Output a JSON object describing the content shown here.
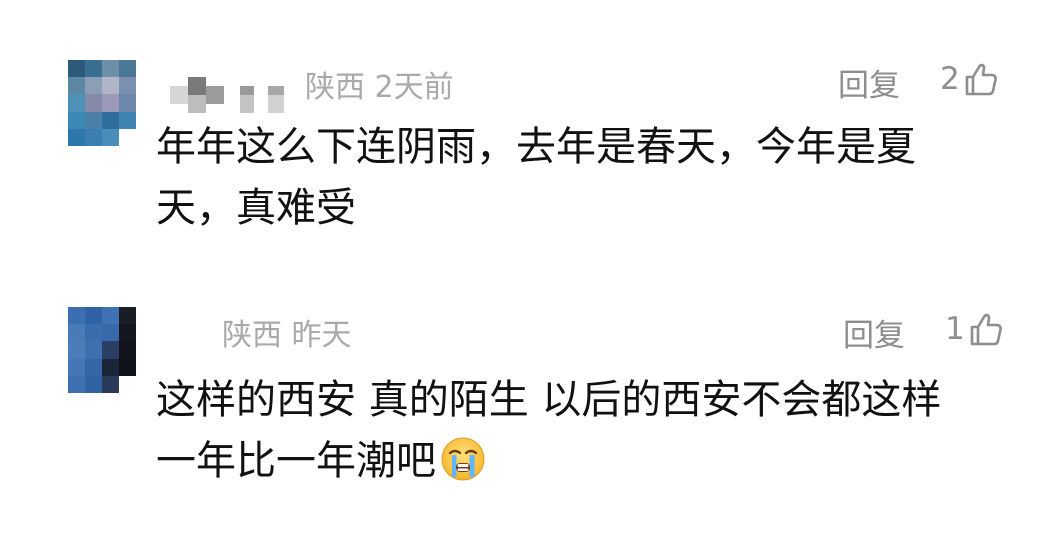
{
  "comments": [
    {
      "location": "陕西",
      "time": "2天前",
      "text_lines": [
        "年年这么下连阴雨，去年是春天，今年是夏",
        "天，真难受"
      ],
      "reply_label": "回复",
      "like_count": "2",
      "like_icon": "thumbs-up-icon"
    },
    {
      "location": "陕西",
      "time": "昨天",
      "text_lines": [
        "这样的西安 真的陌生 以后的西安不会都这样",
        "一年比一年潮吧"
      ],
      "emoji": "crying-face-emoji",
      "reply_label": "回复",
      "like_count": "1",
      "like_icon": "thumbs-up-icon"
    }
  ],
  "colors": {
    "text": "#111111",
    "meta": "#a9a9a9",
    "action": "#8e8e8e",
    "background": "#ffffff"
  }
}
